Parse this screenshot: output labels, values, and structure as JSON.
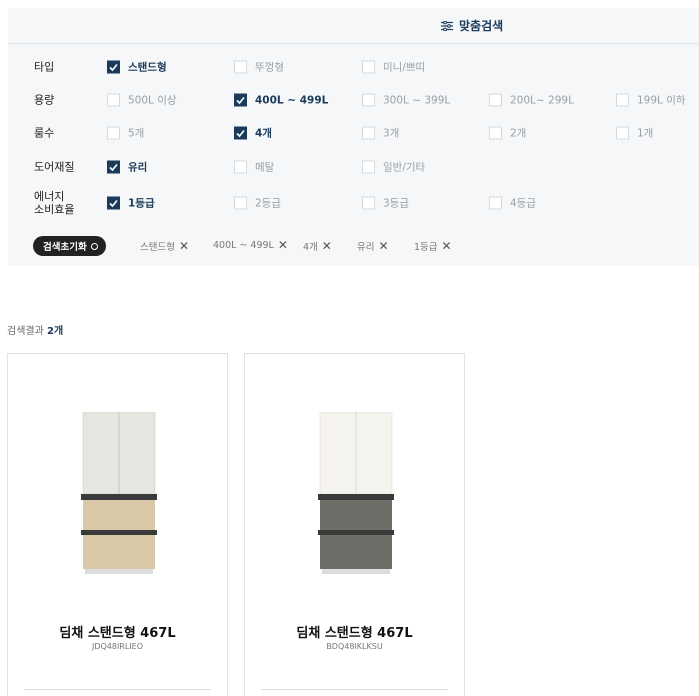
{
  "panel": {
    "title": "맞춤검색"
  },
  "filters": [
    {
      "label": "타입",
      "options": [
        {
          "text": "스탠드형",
          "checked": true
        },
        {
          "text": "뚜껑형",
          "checked": false
        },
        {
          "text": "미니/쁘띠",
          "checked": false
        }
      ]
    },
    {
      "label": "용량",
      "options": [
        {
          "text": "500L 이상",
          "checked": false
        },
        {
          "text": "400L ~ 499L",
          "checked": true
        },
        {
          "text": "300L ~ 399L",
          "checked": false
        },
        {
          "text": "200L~ 299L",
          "checked": false
        },
        {
          "text": "199L 이하",
          "checked": false
        }
      ]
    },
    {
      "label": "룸수",
      "options": [
        {
          "text": "5개",
          "checked": false
        },
        {
          "text": "4개",
          "checked": true
        },
        {
          "text": "3개",
          "checked": false
        },
        {
          "text": "2개",
          "checked": false
        },
        {
          "text": "1개",
          "checked": false
        }
      ]
    },
    {
      "label": "도어재질",
      "options": [
        {
          "text": "유리",
          "checked": true
        },
        {
          "text": "메탈",
          "checked": false
        },
        {
          "text": "일반/기타",
          "checked": false
        }
      ]
    },
    {
      "label": "에너지 소비효율",
      "label_line1": "에너지",
      "label_line2": "소비효율",
      "options": [
        {
          "text": "1등급",
          "checked": true
        },
        {
          "text": "2등급",
          "checked": false
        },
        {
          "text": "3등급",
          "checked": false
        },
        {
          "text": "4등급",
          "checked": false
        }
      ]
    }
  ],
  "reset_label": "검색초기화",
  "chips": [
    "스탠드형",
    "400L ~ 499L",
    "4개",
    "유리",
    "1등급"
  ],
  "results": {
    "label": "검색결과",
    "count": "2개"
  },
  "products": [
    {
      "name": "딤채 스탠드형 467L",
      "model": "JDQ48IRLIEO",
      "colors": {
        "top": "#e6e5e0",
        "bottom": "#d9c8a8",
        "frame": "#3a3a3a"
      }
    },
    {
      "name": "딤채 스탠드형 467L",
      "model": "BDQ48IKLKSU",
      "colors": {
        "top": "#f5f3ee",
        "bottom": "#6e6d68",
        "frame": "#3a3a3a"
      }
    }
  ]
}
